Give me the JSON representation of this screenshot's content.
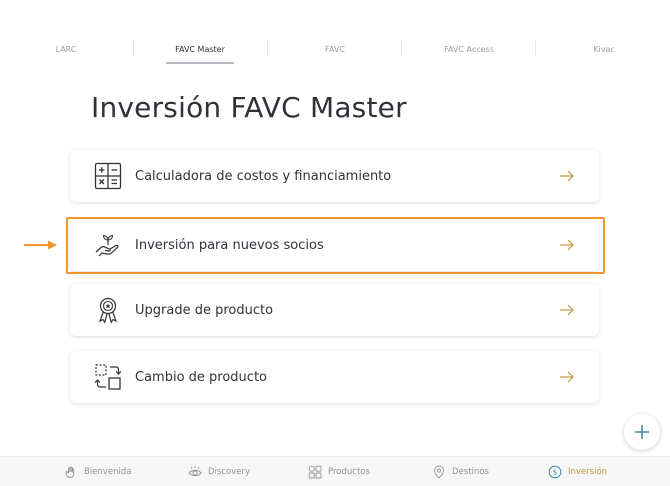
{
  "tabs": [
    {
      "label": "LARC",
      "active": false
    },
    {
      "label": "FAVC Master",
      "active": true
    },
    {
      "label": "FAVC",
      "active": false
    },
    {
      "label": "FAVC Access",
      "active": false
    },
    {
      "label": "Kivac",
      "active": false
    }
  ],
  "page": {
    "title": "Inversión FAVC Master"
  },
  "cards": [
    {
      "label": "Calculadora de costos y financiamiento",
      "icon": "calculator-icon"
    },
    {
      "label": "Inversión para nuevos socios",
      "icon": "hand-plant-icon",
      "highlighted": true
    },
    {
      "label": "Upgrade de producto",
      "icon": "award-ribbon-icon"
    },
    {
      "label": "Cambio de producto",
      "icon": "swap-boxes-icon"
    }
  ],
  "fab": {
    "icon": "plus-icon"
  },
  "bottom_nav": [
    {
      "label": "Bienvenida",
      "icon": "hand-wave-icon",
      "active": false
    },
    {
      "label": "Discovery",
      "icon": "eye-icon",
      "active": false
    },
    {
      "label": "Productos",
      "icon": "grid-icon",
      "active": false
    },
    {
      "label": "Destinos",
      "icon": "location-pin-icon",
      "active": false
    },
    {
      "label": "Inversión",
      "icon": "dollar-coin-icon",
      "active": true
    }
  ],
  "colors": {
    "accent_gold": "#c99540",
    "highlight_orange": "#f0962c",
    "text_dark": "#2f3339",
    "text_muted": "#9a9ea6"
  }
}
